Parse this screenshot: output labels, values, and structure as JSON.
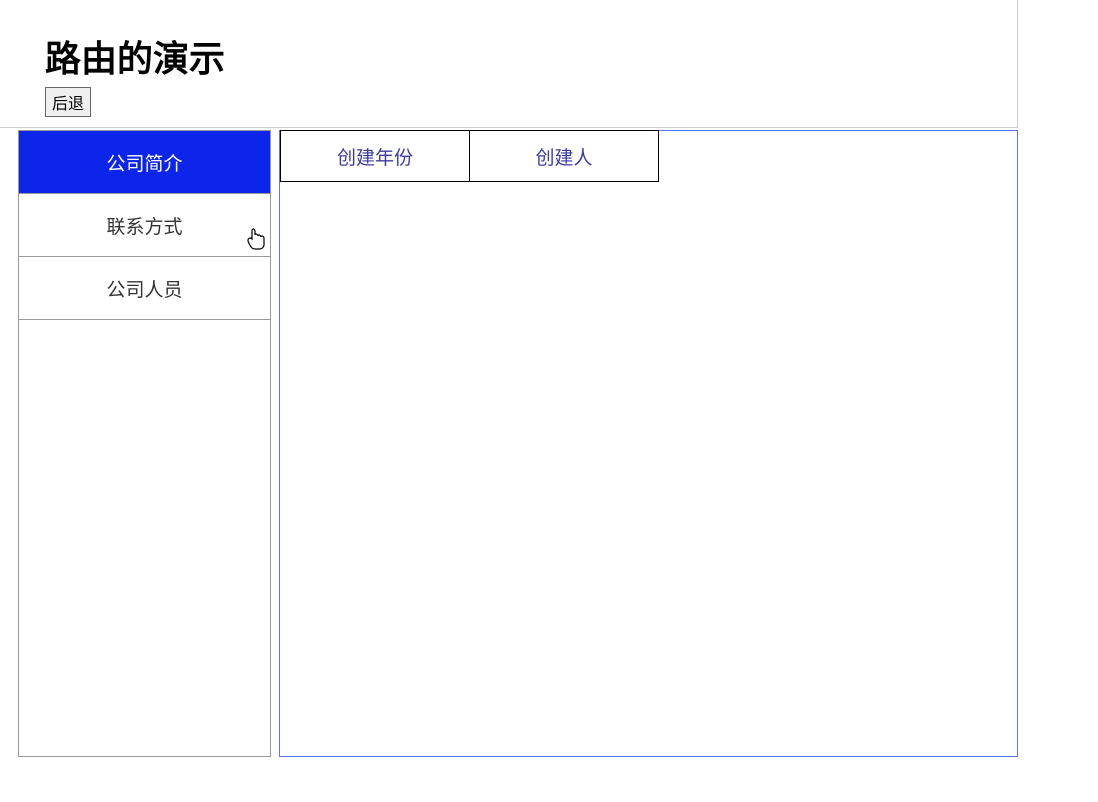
{
  "header": {
    "title": "路由的演示",
    "back_label": "后退"
  },
  "sidebar": {
    "items": [
      {
        "label": "公司简介",
        "active": true
      },
      {
        "label": "联系方式",
        "active": false
      },
      {
        "label": "公司人员",
        "active": false
      }
    ]
  },
  "content": {
    "tabs": [
      {
        "label": "创建年份"
      },
      {
        "label": "创建人"
      }
    ]
  }
}
